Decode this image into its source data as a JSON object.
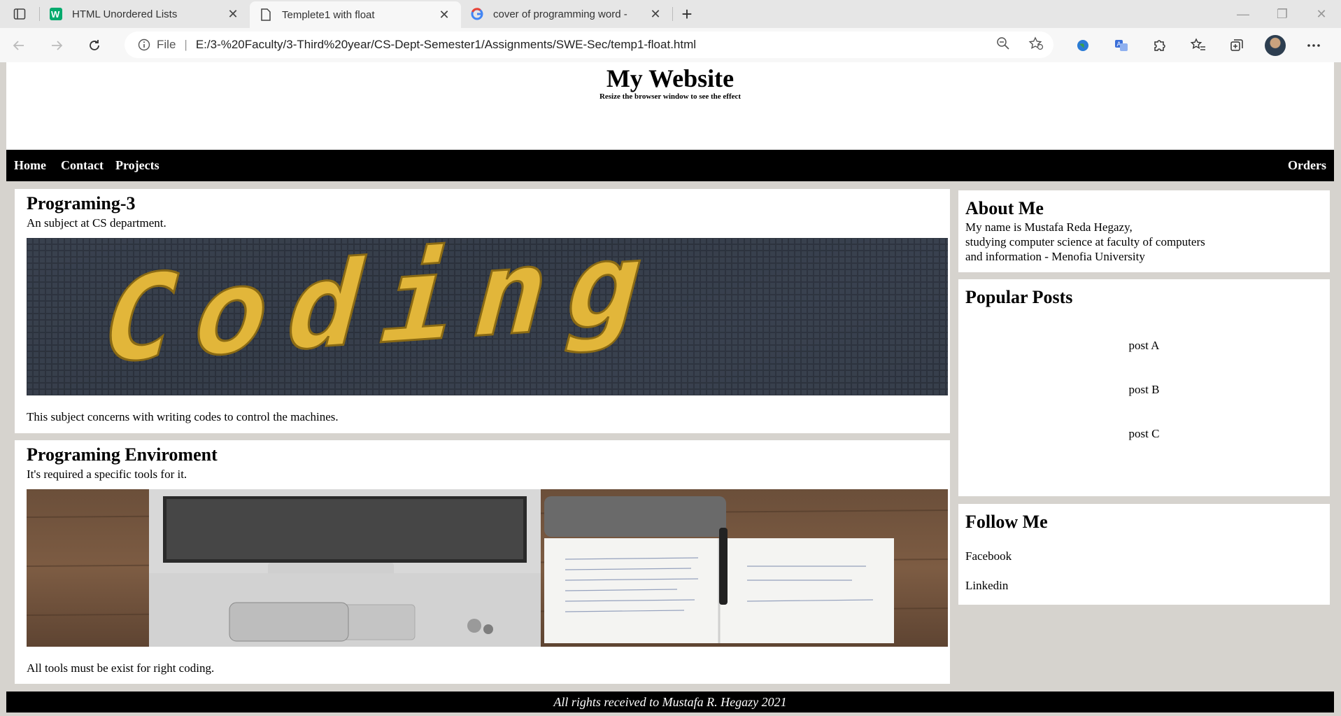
{
  "browser": {
    "tabs": [
      {
        "title": "HTML Unordered Lists",
        "icon": "w3schools-icon"
      },
      {
        "title": "Templete1 with float",
        "icon": "page-icon"
      },
      {
        "title": "cover of programming word - ",
        "icon": "google-icon"
      }
    ],
    "address": {
      "label": "File",
      "url": "E:/3-%20Faculty/3-Third%20year/CS-Dept-Semester1/Assignments/SWE-Sec/temp1-float.html"
    }
  },
  "header": {
    "title": "My Website",
    "subtitle": "Resize the browser window to see the effect"
  },
  "nav": {
    "items": [
      "Home",
      "Contact",
      "Projects"
    ],
    "right_item": "Orders"
  },
  "main": {
    "cards": [
      {
        "title": "Programing-3",
        "intro": "An subject at CS department.",
        "image_text": "Coding",
        "body": "This subject concerns with writing codes to control the machines."
      },
      {
        "title": "Programing Enviroment",
        "intro": "It's required a specific tools for it.",
        "body": "All tools must be exist for right coding."
      }
    ]
  },
  "sidebar": {
    "about": {
      "title": "About Me",
      "lines": [
        "My name is Mustafa Reda Hegazy,",
        "studying computer science at faculty of computers",
        "and information - Menofia University"
      ]
    },
    "popular": {
      "title": "Popular Posts",
      "posts": [
        "post A",
        "post B",
        "post C"
      ]
    },
    "follow": {
      "title": "Follow Me",
      "links": [
        "Facebook",
        "Linkedin"
      ]
    }
  },
  "footer": {
    "text": "All rights received to Mustafa R. Hegazy 2021"
  }
}
